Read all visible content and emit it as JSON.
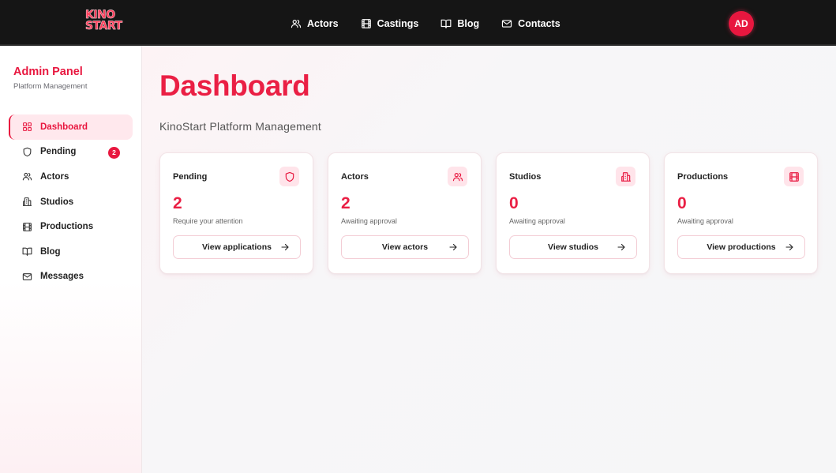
{
  "brand": {
    "logo_line1": "KINO",
    "logo_line2": "START",
    "accent": "#e8173f"
  },
  "topnav": [
    {
      "label": "Actors",
      "icon": "users-icon"
    },
    {
      "label": "Castings",
      "icon": "film-icon"
    },
    {
      "label": "Blog",
      "icon": "book-icon"
    },
    {
      "label": "Contacts",
      "icon": "mail-icon"
    }
  ],
  "user": {
    "initials": "AD"
  },
  "sidebar": {
    "title": "Admin Panel",
    "subtitle": "Platform Management",
    "items": [
      {
        "label": "Dashboard",
        "icon": "grid-icon",
        "active": true
      },
      {
        "label": "Pending",
        "icon": "shield-icon",
        "badge": "2"
      },
      {
        "label": "Actors",
        "icon": "users-icon"
      },
      {
        "label": "Studios",
        "icon": "building-icon"
      },
      {
        "label": "Productions",
        "icon": "film-icon"
      },
      {
        "label": "Blog",
        "icon": "book-icon"
      },
      {
        "label": "Messages",
        "icon": "mail-icon"
      }
    ]
  },
  "main": {
    "title": "Dashboard",
    "subtitle": "KinoStart Platform Management",
    "cards": [
      {
        "label": "Pending",
        "value": "2",
        "desc": "Require your attention",
        "button": "View applications",
        "icon": "shield-icon"
      },
      {
        "label": "Actors",
        "value": "2",
        "desc": "Awaiting approval",
        "button": "View actors",
        "icon": "users-icon"
      },
      {
        "label": "Studios",
        "value": "0",
        "desc": "Awaiting approval",
        "button": "View studios",
        "icon": "building-icon"
      },
      {
        "label": "Productions",
        "value": "0",
        "desc": "Awaiting approval",
        "button": "View productions",
        "icon": "film-icon"
      }
    ]
  }
}
